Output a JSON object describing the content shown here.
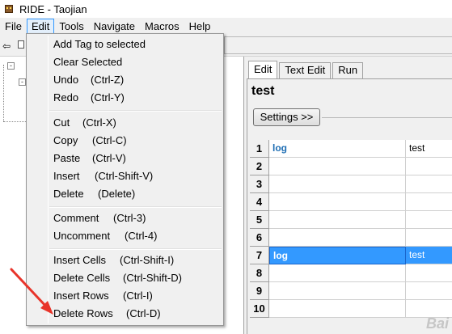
{
  "window": {
    "title": "RIDE - Taojian"
  },
  "menubar": {
    "items": [
      "File",
      "Edit",
      "Tools",
      "Navigate",
      "Macros",
      "Help"
    ],
    "active": "Edit"
  },
  "toolbar": {
    "back_glyph": "⇦"
  },
  "editor": {
    "tabs": [
      "Edit",
      "Text Edit",
      "Run"
    ],
    "active_tab": "Edit",
    "test_name": "test",
    "settings_label": "Settings >>",
    "rows": [
      {
        "num": "1",
        "c1": "log",
        "c2": "test"
      },
      {
        "num": "2",
        "c1": "",
        "c2": ""
      },
      {
        "num": "3",
        "c1": "",
        "c2": ""
      },
      {
        "num": "4",
        "c1": "",
        "c2": ""
      },
      {
        "num": "5",
        "c1": "",
        "c2": ""
      },
      {
        "num": "6",
        "c1": "",
        "c2": ""
      },
      {
        "num": "7",
        "c1": "log",
        "c2": "test"
      },
      {
        "num": "8",
        "c1": "",
        "c2": ""
      },
      {
        "num": "9",
        "c1": "",
        "c2": ""
      },
      {
        "num": "10",
        "c1": "",
        "c2": ""
      }
    ],
    "selected_row": "7"
  },
  "edit_menu": {
    "items": [
      {
        "label": "Add Tag to selected",
        "shortcut": ""
      },
      {
        "label": "Clear Selected",
        "shortcut": ""
      },
      {
        "label": "Undo",
        "shortcut": "(Ctrl-Z)"
      },
      {
        "label": "Redo",
        "shortcut": "(Ctrl-Y)"
      },
      {
        "label": "Cut",
        "shortcut": "(Ctrl-X)"
      },
      {
        "label": "Copy",
        "shortcut": "(Ctrl-C)"
      },
      {
        "label": "Paste",
        "shortcut": "(Ctrl-V)"
      },
      {
        "label": "Insert",
        "shortcut": "(Ctrl-Shift-V)"
      },
      {
        "label": "Delete",
        "shortcut": "(Delete)"
      },
      {
        "label": "Comment",
        "shortcut": "(Ctrl-3)"
      },
      {
        "label": "Uncomment",
        "shortcut": "(Ctrl-4)"
      },
      {
        "label": "Insert Cells",
        "shortcut": "(Ctrl-Shift-I)"
      },
      {
        "label": "Delete Cells",
        "shortcut": "(Ctrl-Shift-D)"
      },
      {
        "label": "Insert Rows",
        "shortcut": "(Ctrl-I)"
      },
      {
        "label": "Delete Rows",
        "shortcut": "(Ctrl-D)"
      }
    ]
  },
  "colors": {
    "keyword": "#1e6eb4",
    "selection": "#3399ff",
    "annotation_arrow": "#e8342a"
  },
  "watermark": {
    "text": "Bai"
  }
}
